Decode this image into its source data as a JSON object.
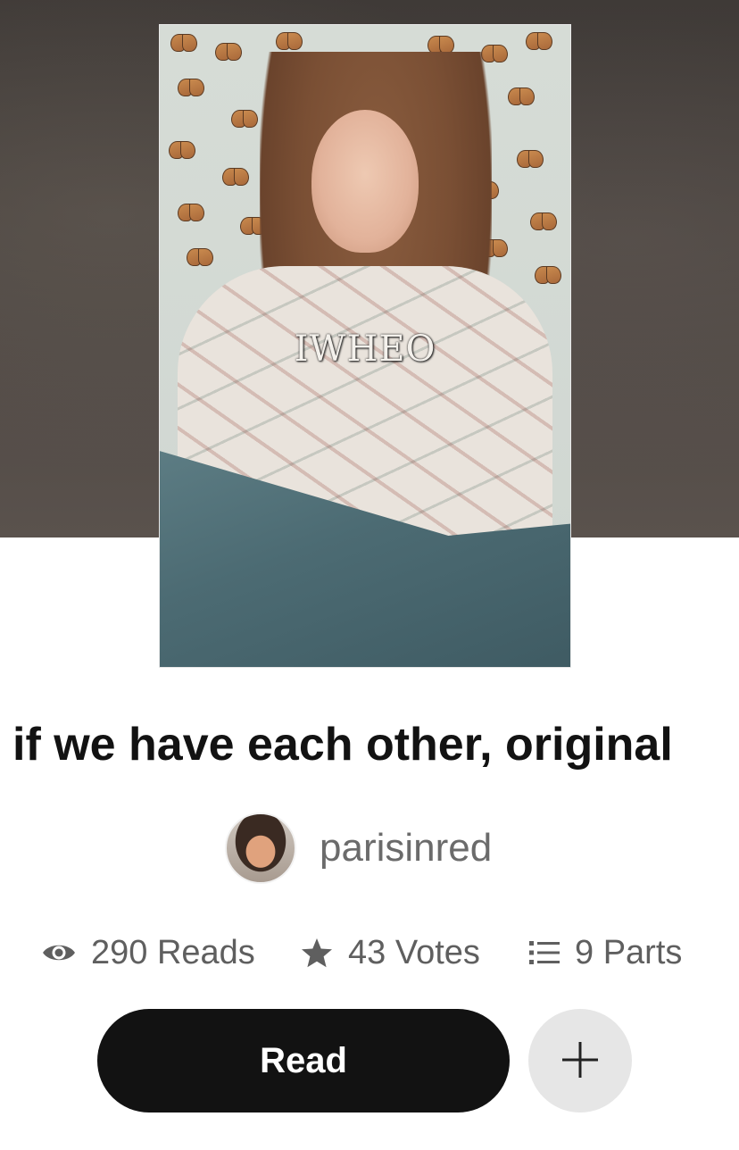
{
  "cover": {
    "overlay_text": "IWHEO"
  },
  "story": {
    "title": "if we have each other,  original"
  },
  "author": {
    "username": "parisinred"
  },
  "stats": {
    "reads": "290 Reads",
    "votes": "43 Votes",
    "parts": "9 Parts"
  },
  "actions": {
    "read_label": "Read",
    "add_icon": "plus-icon"
  },
  "icons": {
    "reads": "eye-icon",
    "votes": "star-icon",
    "parts": "list-icon"
  },
  "colors": {
    "primary_button": "#121212",
    "secondary_button": "#e6e6e6",
    "stat_text": "#5f5f5f",
    "author_text": "#6b6b6b"
  }
}
